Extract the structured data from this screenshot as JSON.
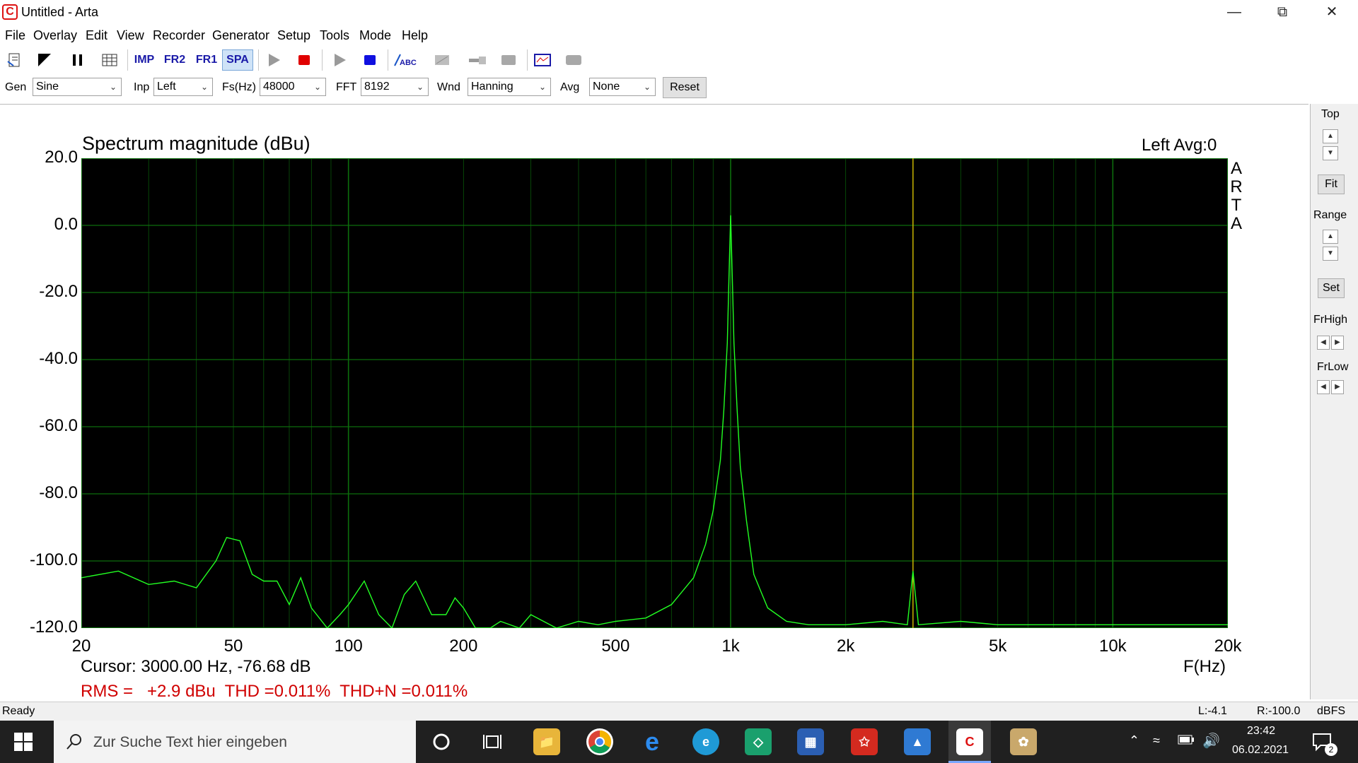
{
  "window": {
    "title": "Untitled - Arta"
  },
  "menu": [
    "File",
    "Overlay",
    "Edit",
    "View",
    "Recorder",
    "Generator",
    "Setup",
    "Tools",
    "Mode",
    "Help"
  ],
  "toolbar": {
    "imp": "IMP",
    "fr2": "FR2",
    "fr1": "FR1",
    "spa": "SPA",
    "abc": "ABC"
  },
  "settings": {
    "gen_label": "Gen",
    "gen_value": "Sine",
    "inp_label": "Inp",
    "inp_value": "Left",
    "fs_label": "Fs(Hz)",
    "fs_value": "48000",
    "fft_label": "FFT",
    "fft_value": "8192",
    "wnd_label": "Wnd",
    "wnd_value": "Hanning",
    "avg_label": "Avg",
    "avg_value": "None",
    "reset_label": "Reset"
  },
  "plot": {
    "title": "Spectrum magnitude (dBu)",
    "channel_info": "Left  Avg:0",
    "brand": [
      "A",
      "R",
      "T",
      "A"
    ],
    "x_unit": "F(Hz)",
    "cursor_readout": "Cursor: 3000.00 Hz, -76.68 dB",
    "measurements": "RMS =   +2.9 dBu  THD =0.011%  THD+N =0.011%"
  },
  "right_panel": {
    "top": "Top",
    "fit": "Fit",
    "range": "Range",
    "set": "Set",
    "frhigh": "FrHigh",
    "frlow": "FrLow"
  },
  "status": {
    "ready": "Ready",
    "left_level": "L:-4.1",
    "right_level": "R:-100.0",
    "unit": "dBFS"
  },
  "taskbar": {
    "search_placeholder": "Zur Suche Text hier eingeben",
    "time": "23:42",
    "date": "06.02.2021",
    "notifications": "2"
  },
  "colors": {
    "plot_bg": "#000000",
    "grid": "#0c6d0c",
    "trace": "#22ff22",
    "cursor": "#c8b400",
    "measure_text": "#d00000"
  },
  "chart_data": {
    "type": "line",
    "title": "Spectrum magnitude (dBu)",
    "xlabel": "F(Hz)",
    "ylabel": "",
    "x_scale": "log",
    "xlim": [
      20,
      20000
    ],
    "ylim": [
      -120,
      20
    ],
    "x_ticks": [
      "20",
      "50",
      "100",
      "200",
      "500",
      "1k",
      "2k",
      "5k",
      "10k",
      "20k"
    ],
    "y_ticks": [
      "20.0",
      "0.0",
      "-20.0",
      "-40.0",
      "-60.0",
      "-80.0",
      "-100.0",
      "-120.0"
    ],
    "grid": true,
    "cursor_x": 3000,
    "series": [
      {
        "x": [
          20,
          25,
          30,
          35,
          40,
          45,
          48,
          52,
          56,
          60,
          65,
          70,
          75,
          80,
          88,
          95,
          100,
          110,
          120,
          130,
          140,
          150,
          165,
          180,
          190,
          200,
          215,
          235,
          250,
          280,
          300,
          350,
          400,
          450,
          500,
          600,
          700,
          800,
          860,
          900,
          940,
          960,
          980,
          990,
          1000,
          1010,
          1020,
          1040,
          1060,
          1100,
          1150,
          1250,
          1400,
          1600,
          2000,
          2500,
          2900,
          3000,
          3100,
          4000,
          5000,
          7000,
          10000,
          15000,
          20000
        ],
        "y": [
          -105,
          -103,
          -107,
          -106,
          -108,
          -100,
          -93,
          -94,
          -104,
          -106,
          -106,
          -113,
          -105,
          -114,
          -120,
          -116,
          -113,
          -106,
          -116,
          -120,
          -110,
          -106,
          -116,
          -116,
          -111,
          -114,
          -120,
          -121,
          -118,
          -120,
          -116,
          -120,
          -118,
          -119,
          -118,
          -117,
          -113,
          -105,
          -95,
          -85,
          -70,
          -55,
          -35,
          -15,
          3,
          -15,
          -35,
          -55,
          -72,
          -88,
          -104,
          -114,
          -118,
          -119,
          -119,
          -118,
          -119,
          -103,
          -119,
          -118,
          -119,
          -119,
          -119,
          -119,
          -119
        ]
      }
    ]
  }
}
